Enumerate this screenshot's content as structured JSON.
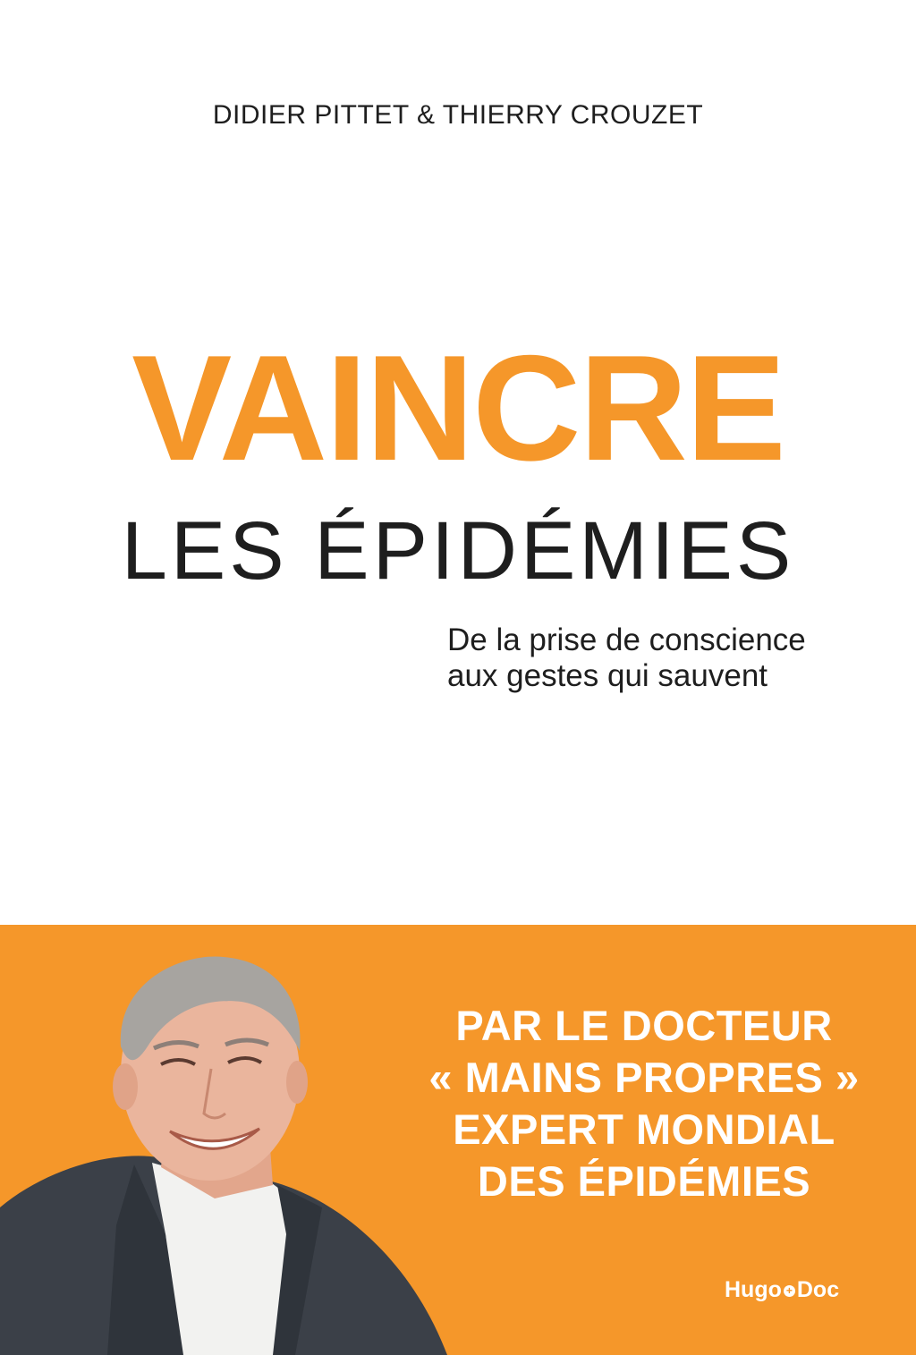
{
  "cover": {
    "authors": "DIDIER PITTET & THIERRY CROUZET",
    "title_main": "VAINCRE",
    "title_sub": "LES ÉPIDÉMIES",
    "subtitle_lines": [
      "De la prise de conscience",
      "aux gestes qui sauvent"
    ],
    "tagline_lines": [
      "PAR LE DOCTEUR",
      "« MAINS PROPRES »",
      "EXPERT MONDIAL",
      "DES ÉPIDÉMIES"
    ],
    "publisher_left": "Hugo",
    "publisher_right": "Doc",
    "publisher_symbol": "+",
    "colors": {
      "accent": "#f5972a",
      "text": "#1e1e1e",
      "background": "#ffffff"
    },
    "photo": "portrait of smiling man in grey suit and white shirt"
  }
}
